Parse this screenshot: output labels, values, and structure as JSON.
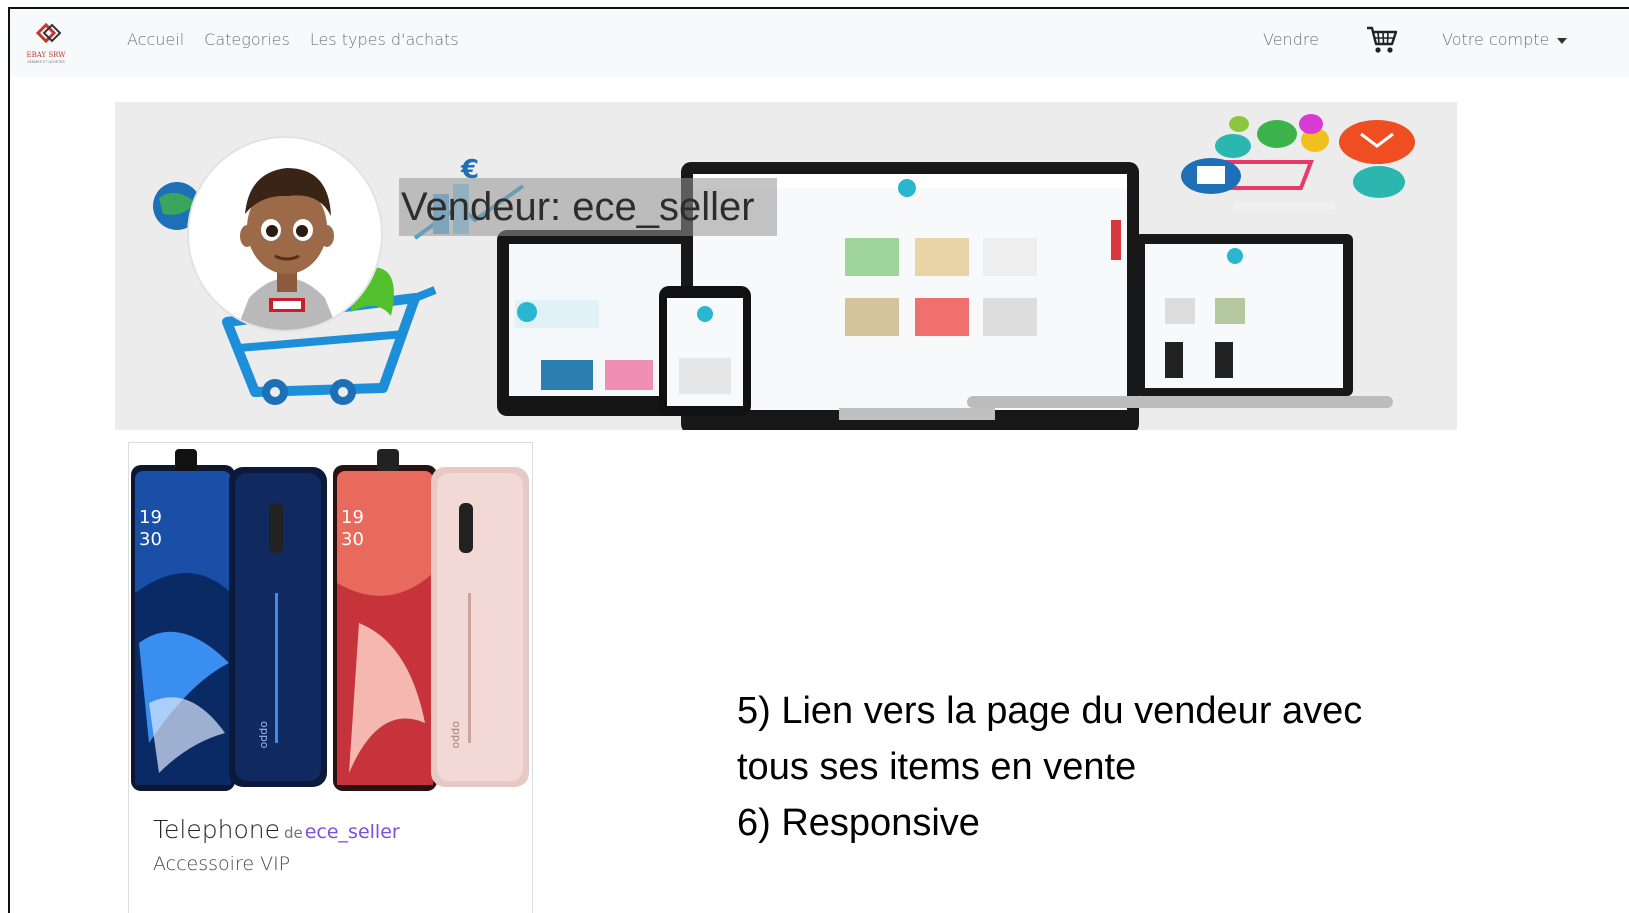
{
  "navbar": {
    "brand_name": "EBAY SRW",
    "brand_tagline": "VENDRE ET ACHETER",
    "links": [
      {
        "label": "Accueil"
      },
      {
        "label": "Categories"
      },
      {
        "label": "Les types d'achats"
      }
    ],
    "sell_label": "Vendre",
    "cart_icon": "shopping-cart-icon",
    "account_label": "Votre compte"
  },
  "banner": {
    "vendor_title": "Vendeur: ece_seller"
  },
  "product": {
    "name": "Telephone",
    "by_label": "de",
    "seller": "ece_seller",
    "category": "Accessoire VIP",
    "phone_time_hour": "19",
    "phone_time_min": "30",
    "phone_brand": "oppo"
  },
  "annotation": {
    "lines": [
      "5) Lien vers la page du vendeur avec",
      "tous ses items en vente",
      "6) Responsive"
    ]
  },
  "colors": {
    "navbar_bg": "#f8f9fa",
    "nav_text": "#6c757d",
    "seller_link": "#7e4ee0",
    "brand_red": "#c0392b"
  }
}
